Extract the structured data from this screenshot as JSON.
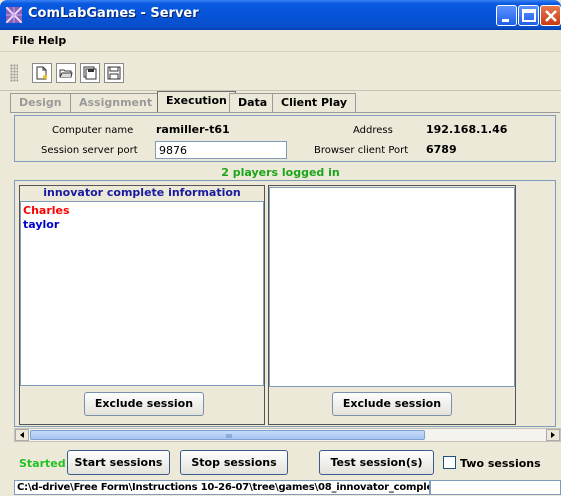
{
  "window": {
    "title": "ComLabGames - Server",
    "icon": "comlab-app-icon"
  },
  "menu": {
    "file": "File",
    "help": "Help"
  },
  "toolbar": {
    "buttons": [
      "new-document-icon",
      "open-folder-icon",
      "save-all-icon",
      "save-icon"
    ]
  },
  "tabs": [
    {
      "label": "Design",
      "state": "disabled"
    },
    {
      "label": "Assignment",
      "state": "disabled"
    },
    {
      "label": "Execution",
      "state": "active"
    },
    {
      "label": "Data",
      "state": "normal"
    },
    {
      "label": "Client Play",
      "state": "normal"
    }
  ],
  "info": {
    "computer_name_label": "Computer name",
    "computer_name": "ramiller-t61",
    "address_label": "Address",
    "address": "192.168.1.46",
    "session_port_label": "Session server port",
    "session_port": "9876",
    "browser_port_label": "Browser client Port",
    "browser_port": "6789"
  },
  "players_logged": "2 players logged in",
  "sessions": [
    {
      "header": "innovator complete information",
      "players": [
        {
          "name": "Charles",
          "color": "#ff0000"
        },
        {
          "name": "taylor",
          "color": "#0000cc"
        }
      ],
      "exclude_label": "Exclude session"
    },
    {
      "header": "",
      "players": [],
      "exclude_label": "Exclude session"
    }
  ],
  "controls": {
    "status": "Started",
    "status_color": "#23c223",
    "start": "Start sessions",
    "stop": "Stop sessions",
    "test": "Test session(s)",
    "two_sessions": "Two sessions",
    "two_sessions_checked": false
  },
  "path": "C:\\d-drive\\Free Form\\Instructions 10-26-07\\tree\\games\\08_innovator_comple..."
}
